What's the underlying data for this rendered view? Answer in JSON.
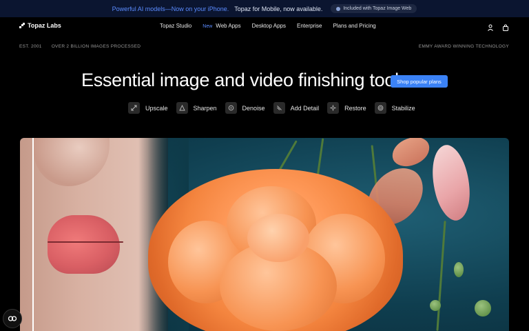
{
  "announcement": {
    "lead": "Powerful AI models—Now on your iPhone.",
    "rest": "Topaz for Mobile, now available.",
    "pill": "Included with Topaz Image Web"
  },
  "nav": {
    "brand": "Topaz Labs",
    "links": [
      "Topaz Studio",
      "Web Apps",
      "Desktop Apps",
      "Enterprise",
      "Plans and Pricing"
    ],
    "new_badge": "New",
    "icons": [
      "user-icon",
      "bag-icon"
    ]
  },
  "meta": {
    "left": [
      "EST. 2001",
      "OVER 2 BILLION IMAGES PROCESSED"
    ],
    "right": "EMMY AWARD WINNING TECHNOLOGY"
  },
  "hero": {
    "title": "Essential image and video finishing tools.",
    "cta": "Shop popular plans"
  },
  "features": [
    {
      "label": "Upscale",
      "icon": "upscale-icon"
    },
    {
      "label": "Sharpen",
      "icon": "sharpen-icon"
    },
    {
      "label": "Denoise",
      "icon": "denoise-icon"
    },
    {
      "label": "Add Detail",
      "icon": "add-detail-icon"
    },
    {
      "label": "Restore",
      "icon": "restore-icon"
    },
    {
      "label": "Stabilize",
      "icon": "stabilize-icon"
    }
  ],
  "colors": {
    "accent": "#3b82f6",
    "announce_bg": "#0b1530",
    "lead": "#5b8cff"
  }
}
